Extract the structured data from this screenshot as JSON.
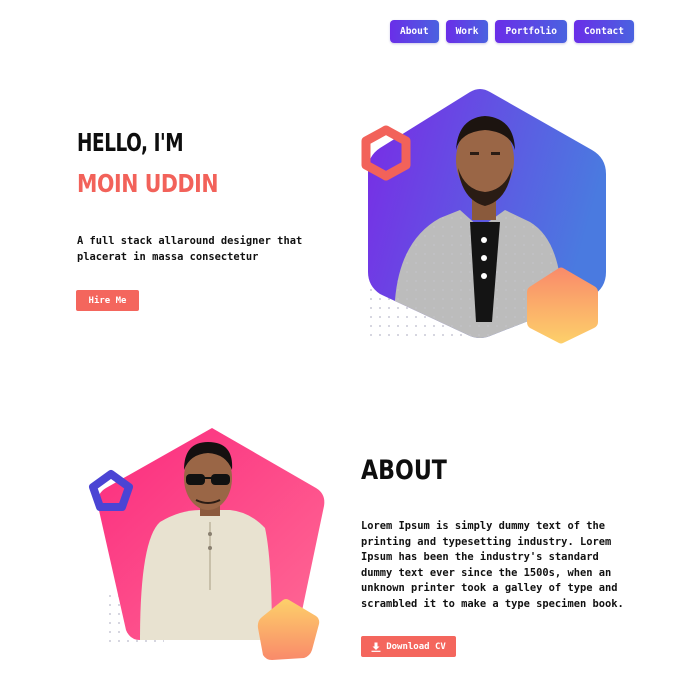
{
  "nav": {
    "items": [
      {
        "label": "About"
      },
      {
        "label": "Work"
      },
      {
        "label": "Portfolio"
      },
      {
        "label": "Contact"
      }
    ]
  },
  "hero": {
    "greeting": "HELLO, I'M",
    "name": "MOIN UDDIN",
    "description": "A full stack allaround designer that placerat in massa consectetur",
    "cta_label": "Hire Me"
  },
  "about": {
    "title": "ABOUT",
    "text": "Lorem Ipsum is simply dummy text of the printing and typesetting industry. Lorem Ipsum has been the industry's standard dummy text ever since the 1500s, when an unknown printer took a galley of type and scrambled it to make a type specimen book.",
    "cta_label": "Download CV",
    "cta_icon": "download-icon"
  },
  "colors": {
    "accent": "#f4665d",
    "nav_gradient_start": "#6a2ee8",
    "nav_gradient_end": "#4a62e0",
    "hero_shape_start": "#7a2ae6",
    "hero_shape_end": "#4a7ae0",
    "about_shape_start": "#fb2b7e",
    "about_shape_end": "#ff5c8f",
    "orange_start": "#fdd06a",
    "orange_end": "#f98a6a"
  }
}
